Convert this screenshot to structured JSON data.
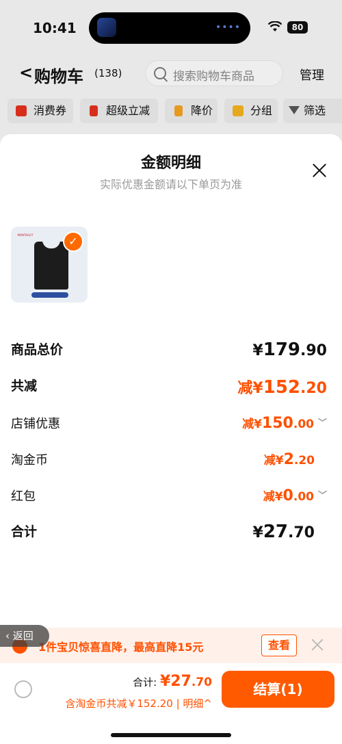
{
  "status_bar": {
    "time": "10:41",
    "battery": "80"
  },
  "header": {
    "back": "<",
    "title": "购物车",
    "count": "(138)",
    "search_placeholder": "搜索购物车商品",
    "manage": "管理"
  },
  "filters": [
    "消费券",
    "超级立减",
    "降价",
    "分组",
    "筛选"
  ],
  "sheet": {
    "title": "金额明细",
    "subtitle": "实际优惠金额请以下单页为准",
    "product_logo": "MONTAGUT",
    "rows": {
      "goods_total": {
        "label": "商品总价",
        "currency": "¥",
        "int": "179",
        "dec": ".90"
      },
      "total_reduce": {
        "label": "共减",
        "prefix": "减¥",
        "int": "152",
        "dec": ".20"
      },
      "shop_discount": {
        "label": "店铺优惠",
        "prefix": "减¥",
        "int": "150",
        "dec": ".00"
      },
      "taojinbi": {
        "label": "淘金币",
        "prefix": "减¥",
        "int": "2",
        "dec": ".20"
      },
      "red_packet": {
        "label": "红包",
        "prefix": "减¥",
        "int": "0",
        "dec": ".00"
      },
      "sum": {
        "label": "合计",
        "currency": "¥",
        "int": "27",
        "dec": ".70"
      }
    }
  },
  "promo": {
    "text": "1件宝贝惊喜直降，最高直降15元",
    "button": "查看"
  },
  "back_pill": "返回",
  "bottom_bar": {
    "total_label": "合计:",
    "total_currency": "¥",
    "total_int": "27",
    "total_dec": ".70",
    "sub_text": "含淘金币共减￥152.20 | 明细",
    "sub_arrow": "^",
    "checkout": "结算(1)"
  },
  "colors": {
    "accent": "#ff5000",
    "checkout": "#ff5a00"
  }
}
